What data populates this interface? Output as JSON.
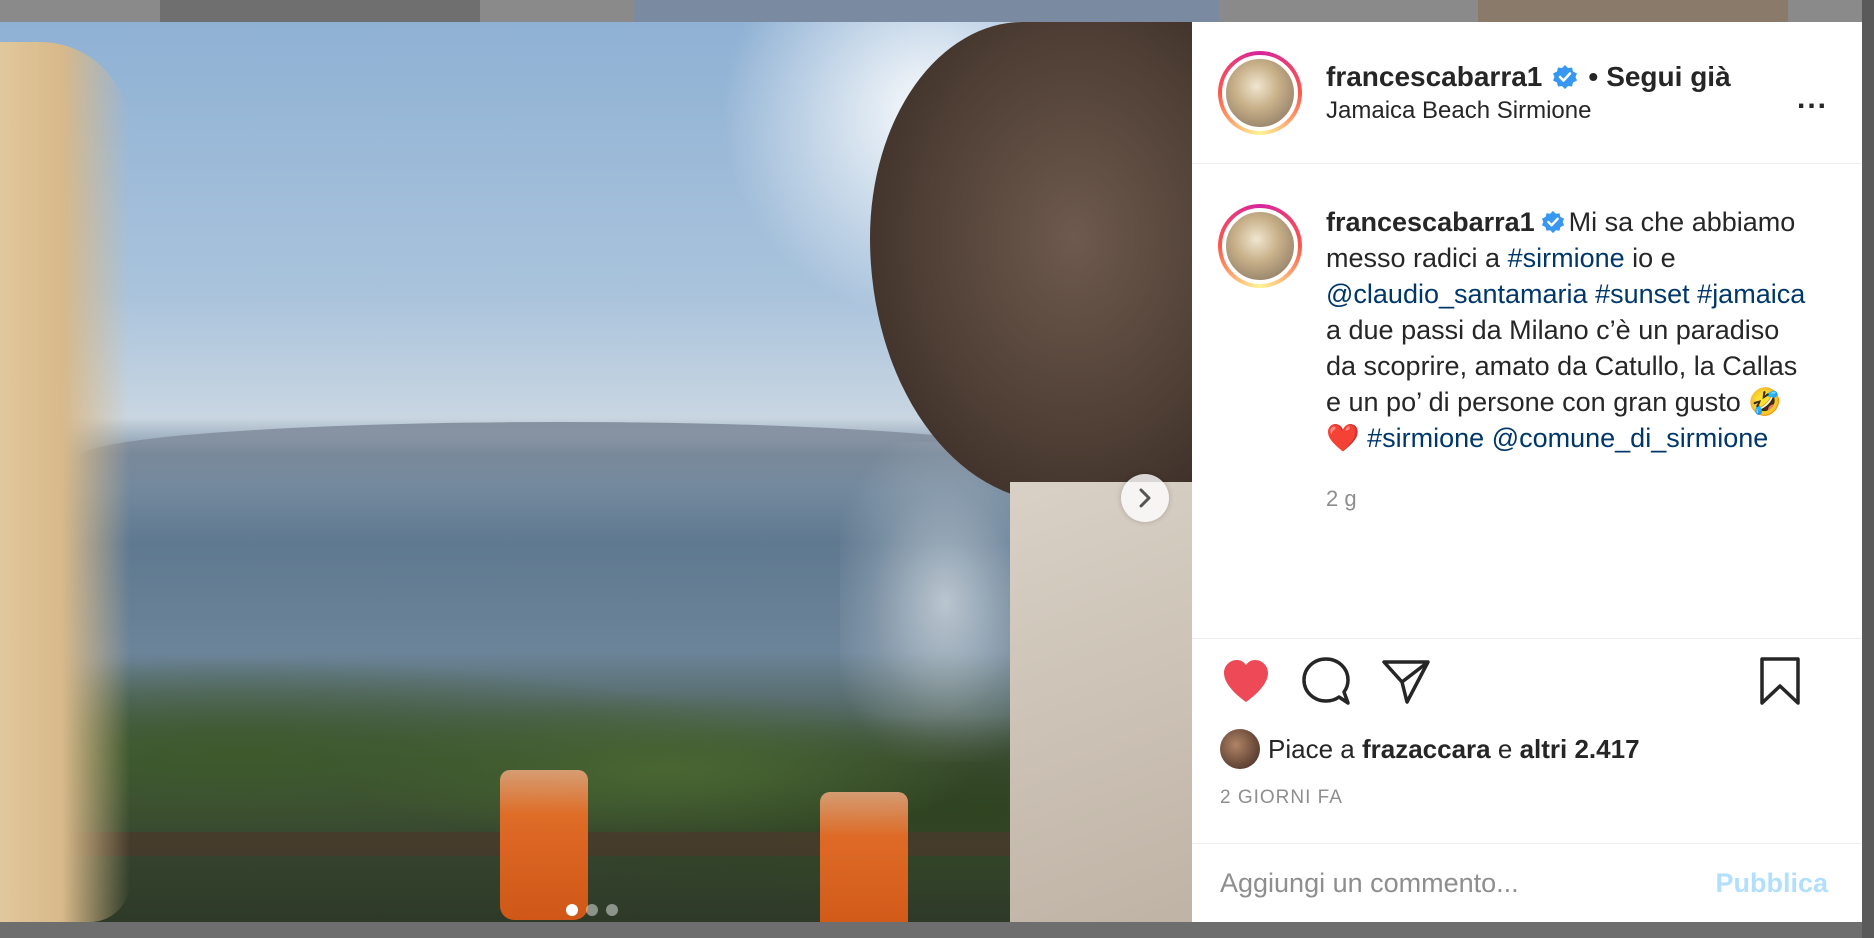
{
  "post": {
    "username": "francescabarra1",
    "verified": true,
    "follow_status": "Segui già",
    "separator": "•",
    "location": "Jamaica Beach Sirmione",
    "more_icon": "more-horizontal-icon",
    "more_label": "..."
  },
  "photo": {
    "carousel_index": 1,
    "carousel_total": 3,
    "next_icon": "chevron-right-icon"
  },
  "caption": {
    "username": "francescabarra1",
    "segments": [
      {
        "text": "Mi sa che abbiamo messo radici a ",
        "type": "text"
      },
      {
        "text": "#sirmione",
        "type": "link"
      },
      {
        "text": " io e ",
        "type": "text"
      },
      {
        "text": "@claudio_santamaria",
        "type": "link"
      },
      {
        "text": " ",
        "type": "text"
      },
      {
        "text": "#sunset",
        "type": "link"
      },
      {
        "text": " ",
        "type": "text"
      },
      {
        "text": "#jamaica",
        "type": "link"
      },
      {
        "text": " a due passi da Milano c’è un paradiso da scoprire, amato da Catullo, la Callas e un po’ di persone con gran gusto ",
        "type": "text"
      },
      {
        "text": "🤣❤️",
        "type": "emoji"
      },
      {
        "text": " ",
        "type": "text"
      },
      {
        "text": "#sirmione",
        "type": "link"
      },
      {
        "text": " ",
        "type": "text"
      },
      {
        "text": "@comune_di_sirmione",
        "type": "link"
      }
    ],
    "time_ago": "2 g"
  },
  "actions": {
    "like_icon": "heart-filled-icon",
    "comment_icon": "comment-bubble-icon",
    "share_icon": "paper-plane-icon",
    "save_icon": "bookmark-icon",
    "like_color": "#ed4956"
  },
  "likes": {
    "prefix": "Piace a",
    "first_liker": "frazaccara",
    "connector": "e",
    "others": "altri 2.417"
  },
  "posted_date": "2 GIORNI FA",
  "comment_box": {
    "placeholder": "Aggiungi un commento...",
    "publish_label": "Pubblica",
    "publish_color": "#b2dffc"
  },
  "colors": {
    "link": "#00376b",
    "verified": "#3897f0",
    "secondary_text": "#8e8e8e"
  }
}
